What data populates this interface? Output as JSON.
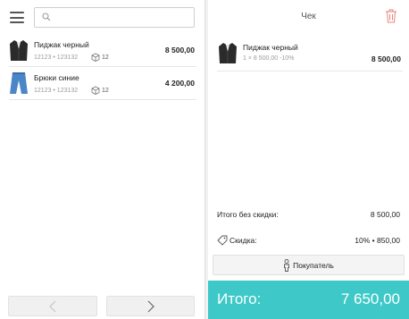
{
  "search": {
    "value": "",
    "placeholder": ""
  },
  "products": [
    {
      "name": "Пиджак черный",
      "code": "12123 • 123132",
      "stock": "12",
      "price": "8 500,00",
      "icon": "jacket-icon"
    },
    {
      "name": "Брюки синие",
      "code": "12123 • 123132",
      "stock": "12",
      "price": "4 200,00",
      "icon": "trousers-icon"
    }
  ],
  "receipt": {
    "title": "Чек",
    "items": [
      {
        "name": "Пиджак черный",
        "detail": "1 × 8 500,00 -10%",
        "price": "8 500,00",
        "icon": "jacket-icon"
      }
    ],
    "subtotal_label": "Итого без скидки:",
    "subtotal_value": "8 500,00",
    "discount_label": "Скидка:",
    "discount_value": "10% • 850,00",
    "customer_label": "Покупатель",
    "total_label": "Итого:",
    "total_value": "7 650,00"
  },
  "colors": {
    "accent": "#3ec8c8",
    "trash": "#e8837a"
  }
}
